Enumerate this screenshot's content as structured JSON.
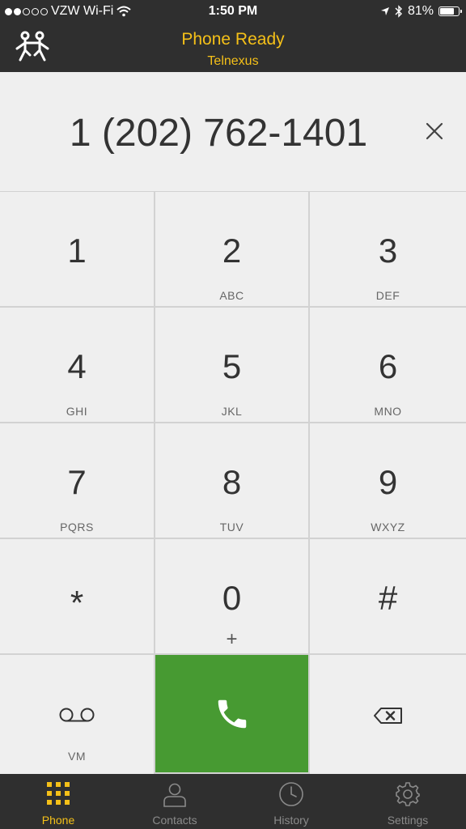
{
  "status_bar": {
    "carrier": "VZW Wi-Fi",
    "time": "1:50 PM",
    "battery": "81%",
    "battery_level": 0.81,
    "signal_dots_filled": 2,
    "signal_dots_total": 5
  },
  "header": {
    "title": "Phone Ready",
    "subtitle": "Telnexus",
    "logo_icon": "people-logo-icon",
    "accent_color": "#f5c018"
  },
  "display": {
    "number": "1 (202) 762-1401",
    "clear_icon": "close-icon"
  },
  "keypad": {
    "keys": [
      {
        "digit": "1",
        "letters": ""
      },
      {
        "digit": "2",
        "letters": "ABC"
      },
      {
        "digit": "3",
        "letters": "DEF"
      },
      {
        "digit": "4",
        "letters": "GHI"
      },
      {
        "digit": "5",
        "letters": "JKL"
      },
      {
        "digit": "6",
        "letters": "MNO"
      },
      {
        "digit": "7",
        "letters": "PQRS"
      },
      {
        "digit": "8",
        "letters": "TUV"
      },
      {
        "digit": "9",
        "letters": "WXYZ"
      },
      {
        "digit": "*",
        "letters": ""
      },
      {
        "digit": "0",
        "letters": "+"
      },
      {
        "digit": "#",
        "letters": ""
      }
    ],
    "voicemail_label": "VM",
    "call_color": "#479a32"
  },
  "tabs": [
    {
      "label": "Phone",
      "icon": "keypad-grid-icon",
      "active": true
    },
    {
      "label": "Contacts",
      "icon": "person-icon",
      "active": false
    },
    {
      "label": "History",
      "icon": "clock-icon",
      "active": false
    },
    {
      "label": "Settings",
      "icon": "gear-icon",
      "active": false
    }
  ]
}
